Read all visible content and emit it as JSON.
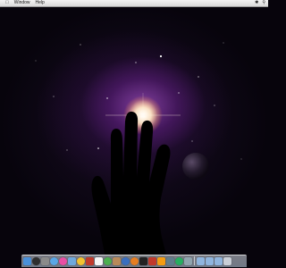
{
  "menubar": {
    "apple_icon": "apple-icon",
    "items": [
      {
        "label": "Window"
      },
      {
        "label": "Help"
      }
    ],
    "right_glyphs": [
      {
        "icon": "bluetooth-icon",
        "glyph": "✱"
      },
      {
        "icon": "spotlight-icon",
        "glyph": "⚲"
      }
    ]
  },
  "wallpaper": {
    "subject": "hand-reaching-to-galaxy",
    "glow_color": "#fff0dc",
    "nebula_color": "#8c46aa"
  },
  "dock": {
    "icons": [
      {
        "name": "finder-icon",
        "color": "#4a90d9"
      },
      {
        "name": "dashboard-icon",
        "color": "#2f2f2f",
        "round": true
      },
      {
        "name": "system-preferences-icon",
        "color": "#8a8a8a"
      },
      {
        "name": "safari-icon",
        "color": "#5aa7e6",
        "round": true
      },
      {
        "name": "itunes-icon",
        "color": "#e94fa4",
        "round": true
      },
      {
        "name": "mail-icon",
        "color": "#6fa8dc"
      },
      {
        "name": "radiation-icon",
        "color": "#f2c230",
        "round": true
      },
      {
        "name": "photos-icon",
        "color": "#c0392b"
      },
      {
        "name": "calendar-icon",
        "color": "#f5f5f5"
      },
      {
        "name": "chat-icon",
        "color": "#4caf50",
        "round": true
      },
      {
        "name": "address-book-icon",
        "color": "#b88a5a"
      },
      {
        "name": "quicktime-icon",
        "color": "#3a6fbf",
        "round": true
      },
      {
        "name": "firefox-icon",
        "color": "#e67e22",
        "round": true
      },
      {
        "name": "terminal-icon",
        "color": "#222222"
      },
      {
        "name": "flag-icon",
        "color": "#c0392b"
      },
      {
        "name": "vlc-icon",
        "color": "#f39c12"
      },
      {
        "name": "camera-icon",
        "color": "#607d8b"
      },
      {
        "name": "time-machine-icon",
        "color": "#27ae60",
        "round": true
      },
      {
        "name": "preview-icon",
        "color": "#90a4ae"
      },
      {
        "name": "applications-folder-icon",
        "color": "#8fb4dd"
      },
      {
        "name": "documents-folder-icon",
        "color": "#8fb4dd"
      },
      {
        "name": "downloads-folder-icon",
        "color": "#8fb4dd"
      },
      {
        "name": "trash-icon",
        "color": "#c9ced6"
      }
    ]
  }
}
